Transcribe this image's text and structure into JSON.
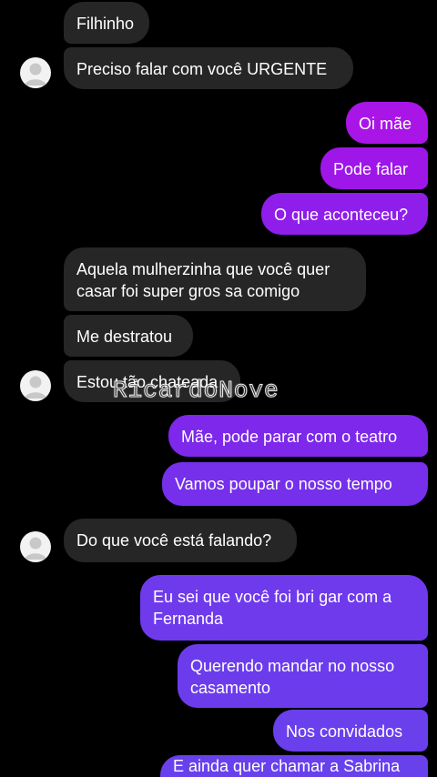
{
  "colors": {
    "incoming_bubble": "#262626",
    "outgoing_purple": "#9a13e6",
    "outgoing_violet": "#6d34ea",
    "background": "#000000"
  },
  "messages": [
    {
      "text": "Filhinho",
      "side": "in"
    },
    {
      "text": "Preciso falar com você URGENTE",
      "side": "in"
    },
    {
      "text": "Oi mãe",
      "side": "out"
    },
    {
      "text": "Pode falar",
      "side": "out"
    },
    {
      "text": "O que aconteceu?",
      "side": "out"
    },
    {
      "text": "Aquela mulherzinha que você quer\ncasar foi super gros sa comigo",
      "side": "in"
    },
    {
      "text": "Me destratou",
      "side": "in"
    },
    {
      "text": "Estou tão chateada",
      "side": "in"
    },
    {
      "text": "Mãe, pode parar com o teatro",
      "side": "out"
    },
    {
      "text": "Vamos poupar o nosso tempo",
      "side": "out"
    },
    {
      "text": "Do que você está falando?",
      "side": "in"
    },
    {
      "text": "Eu sei que você foi bri gar com a\nFernanda",
      "side": "out"
    },
    {
      "text": "Querendo mandar no nosso\ncasamento",
      "side": "out"
    },
    {
      "text": "Nos convidados",
      "side": "out"
    },
    {
      "text": "E ainda quer chamar a Sabrina",
      "side": "out"
    }
  ],
  "watermark": "RicardoNove",
  "avatar_icon": "user-avatar-icon"
}
